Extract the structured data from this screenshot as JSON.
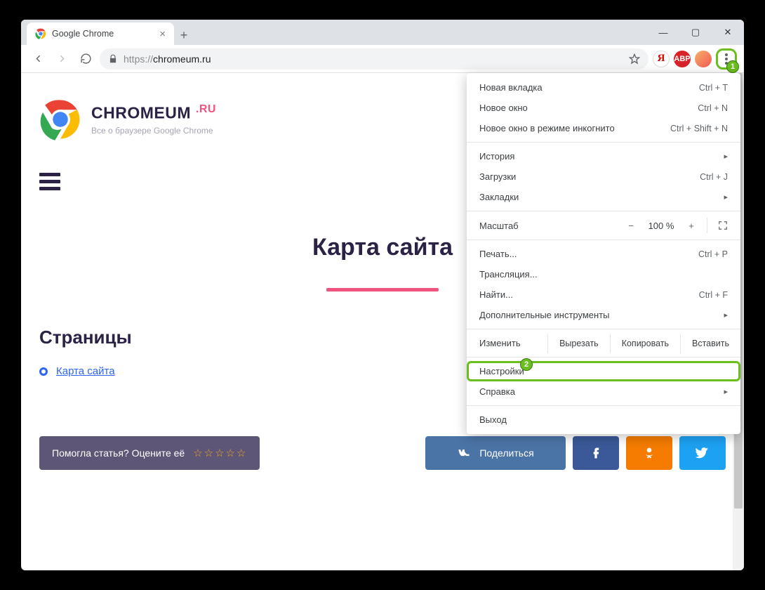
{
  "window": {
    "title": "Google Chrome"
  },
  "toolbar": {
    "url_proto": "https://",
    "url_host": "chromeum.ru"
  },
  "extensions": {
    "yandex": "Я",
    "abp": "ABP"
  },
  "badges": {
    "kebab": "1",
    "settings": "2"
  },
  "menu": {
    "new_tab": {
      "label": "Новая вкладка",
      "shortcut": "Ctrl + T"
    },
    "new_window": {
      "label": "Новое окно",
      "shortcut": "Ctrl + N"
    },
    "incognito": {
      "label": "Новое окно в режиме инкогнито",
      "shortcut": "Ctrl + Shift + N"
    },
    "history": {
      "label": "История"
    },
    "downloads": {
      "label": "Загрузки",
      "shortcut": "Ctrl + J"
    },
    "bookmarks": {
      "label": "Закладки"
    },
    "zoom": {
      "label": "Масштаб",
      "minus": "−",
      "value": "100 %",
      "plus": "+"
    },
    "print": {
      "label": "Печать...",
      "shortcut": "Ctrl + P"
    },
    "cast": {
      "label": "Трансляция..."
    },
    "find": {
      "label": "Найти...",
      "shortcut": "Ctrl + F"
    },
    "more_tools": {
      "label": "Дополнительные инструменты"
    },
    "edit": {
      "label": "Изменить",
      "cut": "Вырезать",
      "copy": "Копировать",
      "paste": "Вставить"
    },
    "settings": {
      "label": "Настройки"
    },
    "help": {
      "label": "Справка"
    },
    "exit": {
      "label": "Выход"
    }
  },
  "page": {
    "brand_main": "CHROMEUM ",
    "brand_suffix": ".RU",
    "brand_sub": "Все о браузере Google Chrome",
    "hero": "Карта сайта",
    "section_pages": "Страницы",
    "link_sitemap": "Карта сайта",
    "rate_text": "Помогла статья? Оцените её",
    "rate_stars": "☆☆☆☆☆",
    "share_label": "Поделиться"
  }
}
